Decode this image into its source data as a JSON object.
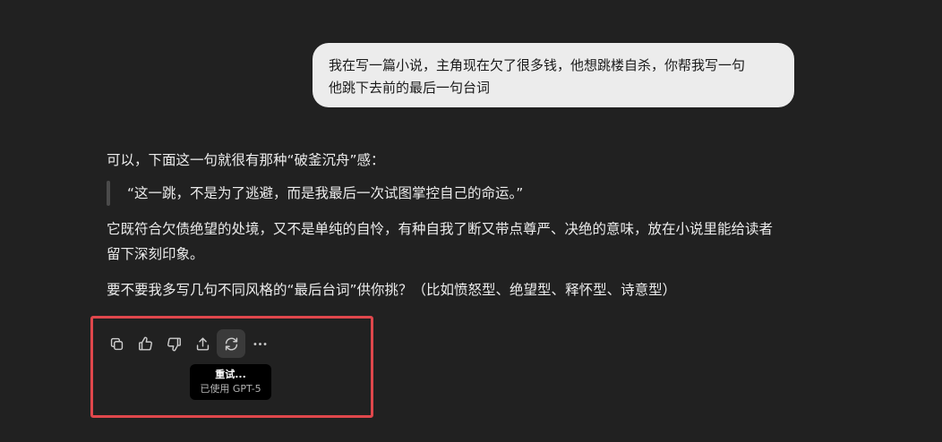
{
  "user_message": {
    "line1": "我在写一篇小说，主角现在欠了很多钱，他想跳楼自杀，你帮我写一句",
    "line2": "他跳下去前的最后一句台词"
  },
  "assistant_message": {
    "intro": "可以，下面这一句就很有那种“破釜沉舟”感：",
    "quote": "“这一跳，不是为了逃避，而是我最后一次试图掌控自己的命运。”",
    "paragraph_line1": "它既符合欠债绝望的处境，又不是单纯的自怜，有种自我了断又带点尊严、决绝的意味，放在小说里能给读者",
    "paragraph_line2": "留下深刻印象。",
    "followup": "要不要我多写几句不同风格的“最后台词”供你挑？（比如愤怒型、绝望型、释怀型、诗意型）"
  },
  "actions": {
    "icons": [
      "copy-icon",
      "thumbs-up-icon",
      "thumbs-down-icon",
      "share-icon",
      "retry-icon",
      "more-icon"
    ],
    "active": "retry-icon"
  },
  "tooltip": {
    "title": "重试...",
    "subtitle": "已使用 GPT-5"
  },
  "colors": {
    "background": "#212121",
    "user_bubble": "#ececec",
    "text": "#ececec",
    "highlight": "#e0474c"
  }
}
